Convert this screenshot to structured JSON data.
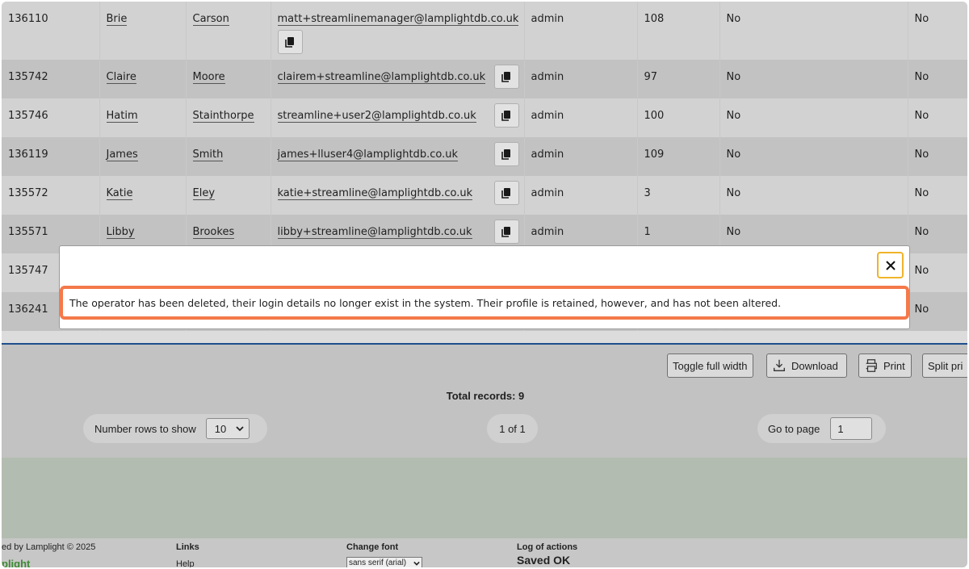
{
  "rows": [
    {
      "id": "136110",
      "first": "Brie",
      "last": "Carson",
      "email": "matt+streamlinemanager@lamplightdb.co.uk",
      "role": "admin",
      "num": "108",
      "c1": "No",
      "c2": "No"
    },
    {
      "id": "135742",
      "first": "Claire",
      "last": "Moore",
      "email": "clairem+streamline@lamplightdb.co.uk",
      "role": "admin",
      "num": "97",
      "c1": "No",
      "c2": "No"
    },
    {
      "id": "135746",
      "first": "Hatim",
      "last": "Stainthorpe",
      "email": "streamline+user2@lamplightdb.co.uk",
      "role": "admin",
      "num": "100",
      "c1": "No",
      "c2": "No"
    },
    {
      "id": "136119",
      "first": "James",
      "last": "Smith",
      "email": "james+lluser4@lamplightdb.co.uk",
      "role": "admin",
      "num": "109",
      "c1": "No",
      "c2": "No"
    },
    {
      "id": "135572",
      "first": "Katie",
      "last": "Eley",
      "email": "katie+streamline@lamplightdb.co.uk",
      "role": "admin",
      "num": "3",
      "c1": "No",
      "c2": "No"
    },
    {
      "id": "135571",
      "first": "Libby",
      "last": "Brookes",
      "email": "libby+streamline@lamplightdb.co.uk",
      "role": "admin",
      "num": "1",
      "c1": "No",
      "c2": "No"
    },
    {
      "id": "135747",
      "first": "",
      "last": "",
      "email": "",
      "role": "",
      "num": "",
      "c1": "",
      "c2": "No"
    },
    {
      "id": "136241",
      "first": "",
      "last": "",
      "email": "",
      "role": "",
      "num": "",
      "c1": "",
      "c2": "No"
    }
  ],
  "toolbar": {
    "toggle_label": "Toggle full width",
    "download_label": "Download",
    "print_label": "Print",
    "split_label": "Split pri"
  },
  "total_records": "Total records: 9",
  "pagination": {
    "rows_label": "Number rows to show",
    "rows_value": "10",
    "page_indicator": "1 of 1",
    "goto_label": "Go to page",
    "goto_value": "1"
  },
  "footer": {
    "powered": "ed by Lamplight © 2025",
    "brand": "plight",
    "links_head": "Links",
    "help": "Help",
    "font_head": "Change font",
    "font_value": "sans serif (arial)",
    "log_head": "Log of actions",
    "log_value": "Saved OK"
  },
  "modal": {
    "message": "The operator has been deleted, their login details no longer exist in the system. Their profile is retained, however, and has not been altered."
  },
  "colors": {
    "highlight_border": "#f4794a",
    "close_focus": "#f0b429",
    "brand_green": "#3e8a35",
    "table_rule": "#1f4e8c"
  }
}
